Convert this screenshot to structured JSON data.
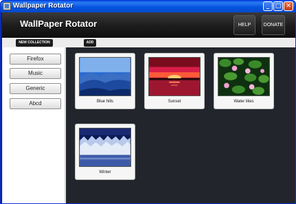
{
  "window": {
    "title": "Wallpaper Rotator",
    "controls": {
      "minimize": "_",
      "maximize": "□",
      "close": "✕"
    }
  },
  "header": {
    "app_name": "WallPaper Rotator",
    "help_label": "HELP",
    "donate_label": "DONATE"
  },
  "tabs": {
    "new_collection": "NEW COLLECTION",
    "add": "ADD"
  },
  "collections": [
    "Firefox",
    "Music",
    "Generic",
    "Abcd"
  ],
  "wallpapers": [
    {
      "label": "Blue hills"
    },
    {
      "label": "Sunset"
    },
    {
      "label": "Water lilies"
    },
    {
      "label": "Winter"
    }
  ],
  "colors": {
    "titlebar": "#0554e0",
    "header": "#1e1e1e",
    "content_bg": "#22262c",
    "sidebar_bg": "#ffffff"
  }
}
